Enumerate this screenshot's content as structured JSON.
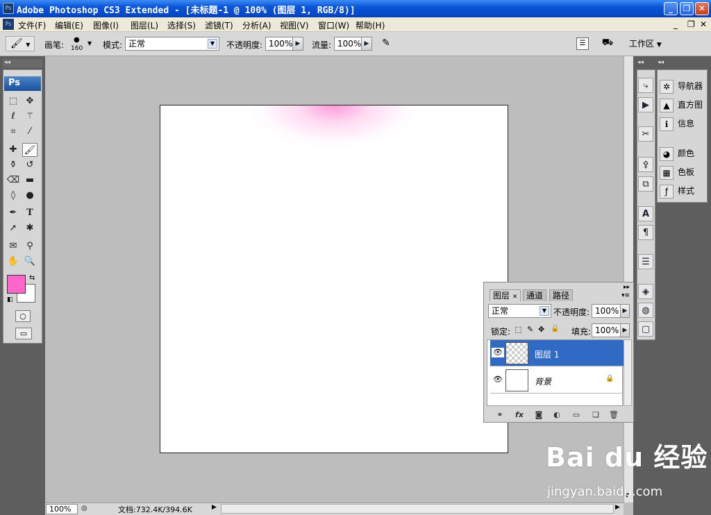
{
  "window": {
    "title": "Adobe Photoshop CS3 Extended - [未标题-1 @ 100% (图层 1, RGB/8)]",
    "app_icon": "Ps",
    "controls": {
      "minimize": "_",
      "restore": "❐",
      "close": "✕"
    }
  },
  "menu": {
    "items": [
      "文件(F)",
      "编辑(E)",
      "图像(I)",
      "图层(L)",
      "选择(S)",
      "滤镜(T)",
      "分析(A)",
      "视图(V)",
      "窗口(W)",
      "帮助(H)"
    ],
    "doc_controls": [
      "_",
      "❐",
      "✕"
    ]
  },
  "options_bar": {
    "brush_label": "画笔:",
    "brush_size": "160",
    "mode_label": "模式:",
    "mode_value": "正常",
    "opacity_label": "不透明度:",
    "opacity_value": "100%",
    "flow_label": "流量:",
    "flow_value": "100%",
    "workspace_label": "工作区"
  },
  "toolbox": {
    "logo": "Ps",
    "foreground_color": "#ff66cc",
    "background_color": "#ffffff"
  },
  "dock": {
    "items": [
      {
        "icon": "navigator-icon",
        "label": "导航器"
      },
      {
        "icon": "histogram-icon",
        "label": "直方图"
      },
      {
        "icon": "info-icon",
        "label": "信息"
      },
      {
        "icon": "color-icon",
        "label": "颜色"
      },
      {
        "icon": "swatches-icon",
        "label": "色板"
      },
      {
        "icon": "styles-icon",
        "label": "样式"
      }
    ]
  },
  "layers_panel": {
    "tabs": [
      "图层",
      "通道",
      "路径"
    ],
    "blend_mode": "正常",
    "opacity_label": "不透明度:",
    "opacity_value": "100%",
    "lock_label": "锁定:",
    "fill_label": "填充:",
    "fill_value": "100%",
    "layers": [
      {
        "name": "图层 1",
        "selected": true,
        "transparent": true,
        "locked": false
      },
      {
        "name": "背景",
        "selected": false,
        "transparent": false,
        "locked": true
      }
    ]
  },
  "status": {
    "zoom": "100%",
    "doc_info": "文档:732.4K/394.6K"
  },
  "watermark": {
    "main": "Bai du 经验",
    "url": "jingyan.baidu.com"
  }
}
